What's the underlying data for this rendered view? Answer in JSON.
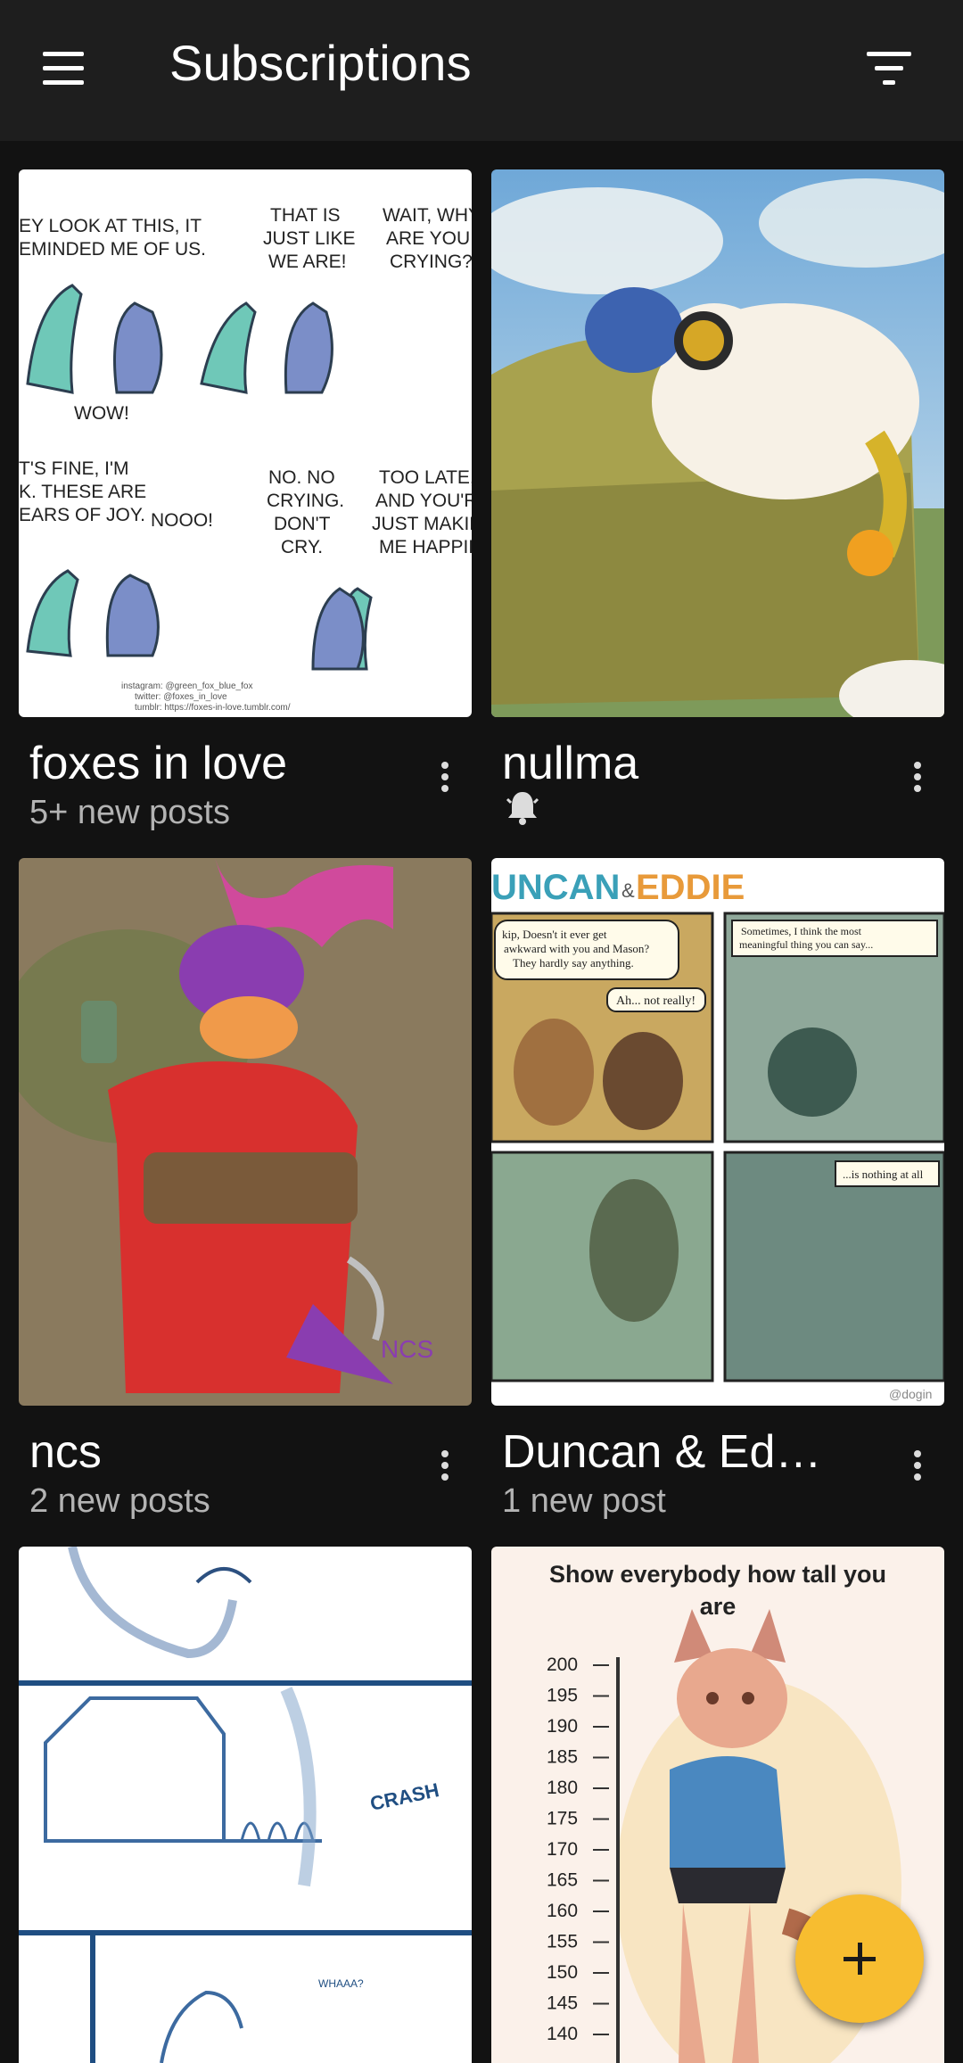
{
  "app_bar": {
    "title": "Subscriptions",
    "menu_icon": "hamburger-menu-icon",
    "filter_icon": "filter-icon"
  },
  "subscriptions": [
    {
      "name": "foxes in love",
      "status": "5+ new posts",
      "thumbnail_text": {
        "p1": "EY LOOK AT THIS, IT\nEMINDED ME OF US.",
        "p2": "THAT IS\nJUST LIKE\nWE ARE!",
        "p3": "WAIT, WHY\nARE YOU\nCRYING?",
        "wow": "WOW!",
        "p4": "T'S FINE, I'M\nK. THESE ARE\nEARS OF JOY.",
        "nooo": "NOOO!",
        "p5": "NO. NO\nCRYING.\nDON'T\nCRY.",
        "p6": "TOO LATE,\nAND YOU'R\nJUST MAKIN\nME HAPPIE",
        "credit": "instagram: @green_fox_blue_fox\ntwitter: @foxes_in_love\ntumblr: https://foxes-in-love.tumblr.com/"
      }
    },
    {
      "name": "nullma",
      "status": "",
      "status_icon": "bell-icon"
    },
    {
      "name": "ncs",
      "status": "2 new posts",
      "thumbnail_text": {
        "signature": "NCS"
      }
    },
    {
      "name": "Duncan & Ed…",
      "status": "1 new post",
      "thumbnail_text": {
        "title_a": "UNCAN",
        "amp": "&",
        "title_b": "EDDIE",
        "b1": "kip, Doesn't it ever get\nawkward with you and Mason?\nThey hardly say anything.",
        "b2": "Ah... not really!",
        "b3": "Sometimes, I think the most\nmeaningful thing you can say...",
        "b4": "...is nothing at all",
        "handle": "@dogin"
      }
    },
    {
      "name": "",
      "status": "",
      "thumbnail_text": {
        "sfx": "CRASH",
        "sfx2": "WHAAA?"
      }
    },
    {
      "name": "",
      "status": "",
      "thumbnail_text": {
        "heading": "Show everybody how tall you\nare",
        "ticks": [
          "200",
          "195",
          "190",
          "185",
          "180",
          "175",
          "170",
          "165",
          "160",
          "155",
          "150",
          "145",
          "140"
        ]
      }
    }
  ],
  "fab": {
    "icon": "plus-icon"
  },
  "colors": {
    "background": "#121212",
    "app_bar": "#1e1e1e",
    "fab": "#f7bd30",
    "secondary_text": "#b3b3b3"
  }
}
